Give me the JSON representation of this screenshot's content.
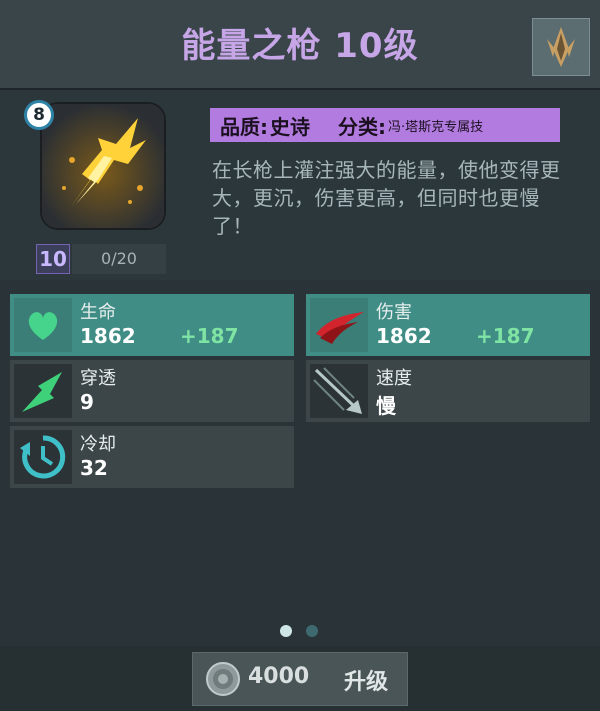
{
  "header": {
    "title": "能量之枪 10级",
    "emblem_icon": "faction-emblem-icon"
  },
  "skill": {
    "icon": "glowing-spear-icon",
    "tier": "8",
    "level": "10",
    "progress": "0/20",
    "quality_label": "品质:",
    "quality_value": "史诗",
    "category_label": "分类:",
    "category_value": "冯·塔斯克专属技",
    "description": "在长枪上灌注强大的能量，使他变得更大，更沉，伤害更高，但同时也更慢了！"
  },
  "stats": {
    "hp": {
      "name": "生命",
      "value": "1862",
      "bonus": "+187",
      "icon": "heart-icon"
    },
    "damage": {
      "name": "伤害",
      "value": "1862",
      "bonus": "+187",
      "icon": "slash-icon"
    },
    "pierce": {
      "name": "穿透",
      "value": "9",
      "icon": "pierce-arrow-icon"
    },
    "speed": {
      "name": "速度",
      "value": "慢",
      "icon": "speed-arrow-icon"
    },
    "cooldown": {
      "name": "冷却",
      "value": "32",
      "icon": "cooldown-clock-icon"
    }
  },
  "pager": {
    "total": 2,
    "active": 0
  },
  "footer": {
    "cost": "4000",
    "upgrade_label": "升级",
    "coin_icon": "coin-icon"
  },
  "colors": {
    "title": "#c7a6e8",
    "quality_bg": "#b27bdf",
    "highlight": "#3f8d84",
    "bonus": "#7fe3a4"
  }
}
